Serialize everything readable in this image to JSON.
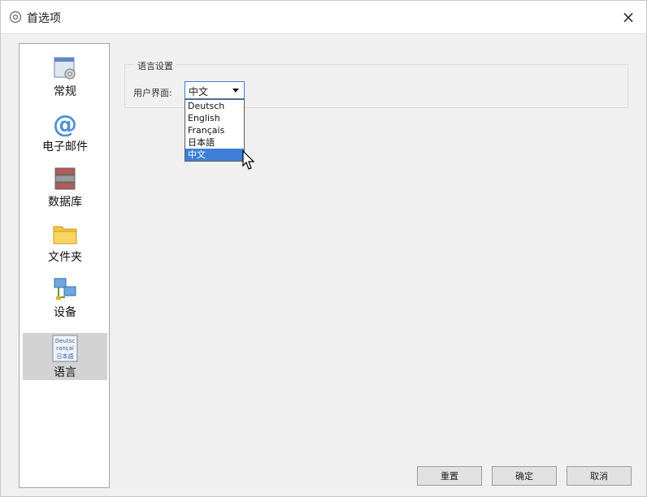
{
  "window": {
    "title": "首选项",
    "title_icon": "gear-icon",
    "close_glyph": "×"
  },
  "nav": {
    "items": [
      {
        "label": "常规",
        "icon": "general-settings-icon"
      },
      {
        "label": "电子邮件",
        "icon": "email-at-icon"
      },
      {
        "label": "数据库",
        "icon": "database-icon"
      },
      {
        "label": "文件夹",
        "icon": "folder-icon"
      },
      {
        "label": "设备",
        "icon": "devices-network-icon"
      },
      {
        "label": "语言",
        "icon": "language-icon",
        "selected": true,
        "icon_text": [
          "Deutsc",
          "rançai",
          "日本語"
        ]
      }
    ]
  },
  "language": {
    "group_title": "语言设置",
    "ui_label": "用户界面:",
    "selected": "中文",
    "options": [
      "Deutsch",
      "English",
      "Français",
      "日本語",
      "中文"
    ],
    "highlighted_option": "中文"
  },
  "buttons": {
    "reset": "重置",
    "ok": "确定",
    "cancel": "取消"
  },
  "colors": {
    "accent": "#3d7fd6",
    "nav_selected": "#d3d3d3",
    "window_bg": "#f0f0f0"
  }
}
